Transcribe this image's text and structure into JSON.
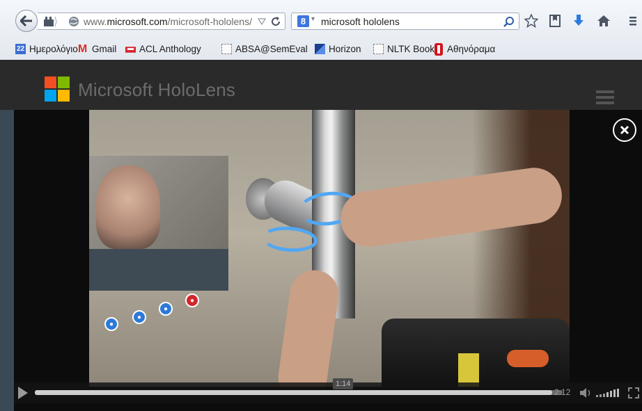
{
  "browser": {
    "url_prefix": "www.",
    "url_domain": "microsoft.com",
    "url_path": "/microsoft-hololens/",
    "search_engine_letter": "8",
    "search_query": "microsoft hololens"
  },
  "bookmarks": [
    {
      "label": "Ημερολόγιο",
      "icon": "calendar-icon",
      "badge": "22"
    },
    {
      "label": "Gmail",
      "icon": "gmail-icon",
      "badge": "M"
    },
    {
      "label": "ACL Anthology",
      "icon": "acl-icon",
      "badge": ""
    },
    {
      "label": "ABSA@SemEval",
      "icon": "page-icon",
      "badge": ""
    },
    {
      "label": "Horizon",
      "icon": "horizon-icon",
      "badge": ""
    },
    {
      "label": "NLTK Book",
      "icon": "page-icon",
      "badge": ""
    },
    {
      "label": "Αθηνόραμα",
      "icon": "athinorama-icon",
      "badge": ""
    }
  ],
  "site": {
    "title": "Microsoft HoloLens",
    "logo_colors": [
      "#f25022",
      "#7fba00",
      "#00a4ef",
      "#ffb900"
    ]
  },
  "player": {
    "hover_time": "1:14",
    "duration": "2:12",
    "progress_fraction": 0.98
  }
}
